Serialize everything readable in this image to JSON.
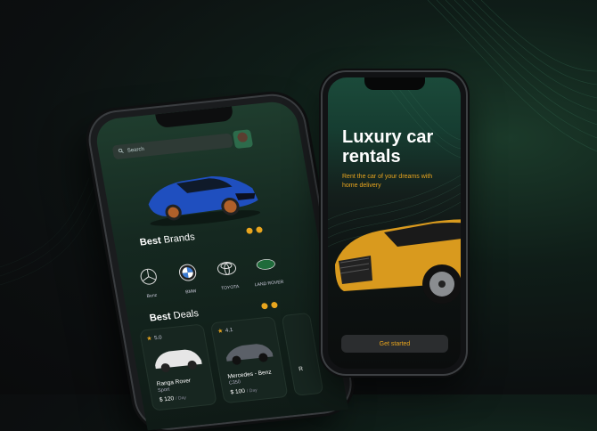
{
  "left_phone": {
    "search": {
      "placeholder": "Search"
    },
    "best_brands": {
      "title_bold": "Best",
      "title_light": " Brands"
    },
    "brands": [
      {
        "name": "Benz",
        "icon": "mercedes-logo-icon"
      },
      {
        "name": "BMW",
        "icon": "bmw-logo-icon"
      },
      {
        "name": "TOYOTA",
        "icon": "toyota-logo-icon"
      },
      {
        "name": "LAND ROVER",
        "icon": "land-rover-logo-icon"
      }
    ],
    "best_deals": {
      "title_bold": "Best",
      "title_light": " Deals"
    },
    "deals": [
      {
        "rating": "5.0",
        "name": "Ranga Rover",
        "sub": "Sport",
        "price": "$ 120",
        "unit": "/ Day"
      },
      {
        "rating": "4.1",
        "name": "Mercedes - Benz",
        "sub": "C350",
        "price": "$ 100",
        "unit": "/ Day"
      },
      {
        "rating": "",
        "name": "R",
        "sub": "",
        "price": "",
        "unit": ""
      }
    ]
  },
  "right_phone": {
    "hero_title": "Luxury car rentals",
    "hero_subtitle": "Rent the car of your dreams with home delivery",
    "cta_label": "Get started"
  },
  "colors": {
    "accent": "#e8a51e",
    "bg": "#0c0f10"
  }
}
